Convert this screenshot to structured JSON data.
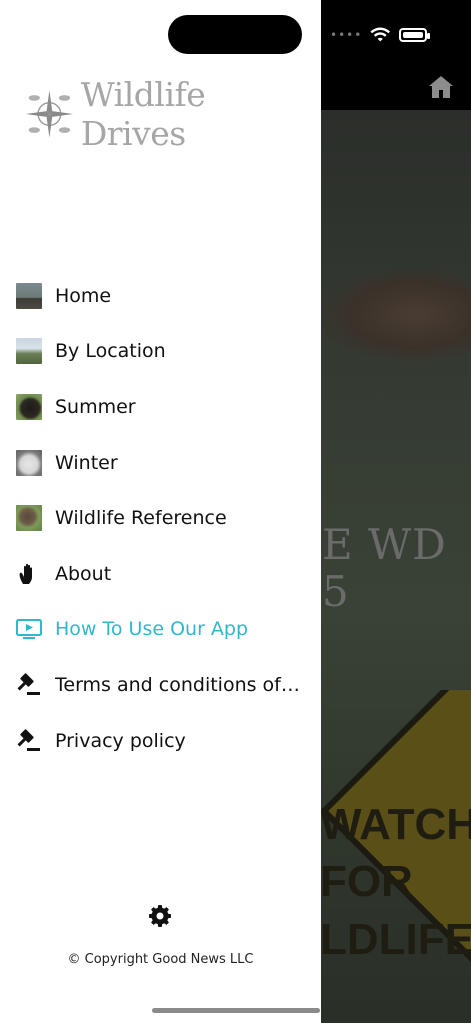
{
  "status_bar": {
    "signal_text": "••••",
    "wifi_icon": "wifi-icon",
    "battery_icon": "battery-icon"
  },
  "header": {
    "home_icon": "home-icon"
  },
  "logo": {
    "text": "Wildlife Drives",
    "emblem_icon": "compass-emblem-icon"
  },
  "menu": {
    "items": [
      {
        "label": "Home",
        "icon": "home-thumbnail"
      },
      {
        "label": "By Location",
        "icon": "location-thumbnail"
      },
      {
        "label": "Summer",
        "icon": "summer-thumbnail"
      },
      {
        "label": "Winter",
        "icon": "winter-thumbnail"
      },
      {
        "label": "Wildlife Reference",
        "icon": "wildlife-reference-thumbnail"
      },
      {
        "label": "About",
        "icon": "hand-icon"
      },
      {
        "label": "How To Use Our App",
        "icon": "video-screen-icon",
        "active": true
      },
      {
        "label": "Terms and conditions of S...",
        "icon": "gavel-icon"
      },
      {
        "label": "Privacy policy",
        "icon": "gavel-icon"
      }
    ],
    "active_color": "#2fb7cc"
  },
  "footer": {
    "settings_icon": "gear-icon",
    "copyright": "© Copyright Good News LLC"
  },
  "background": {
    "text_line_1": "E WD",
    "text_line_2": "5",
    "sign_line_1": "WATCH",
    "sign_line_2": "FOR",
    "sign_line_3": "LDLIFE"
  }
}
